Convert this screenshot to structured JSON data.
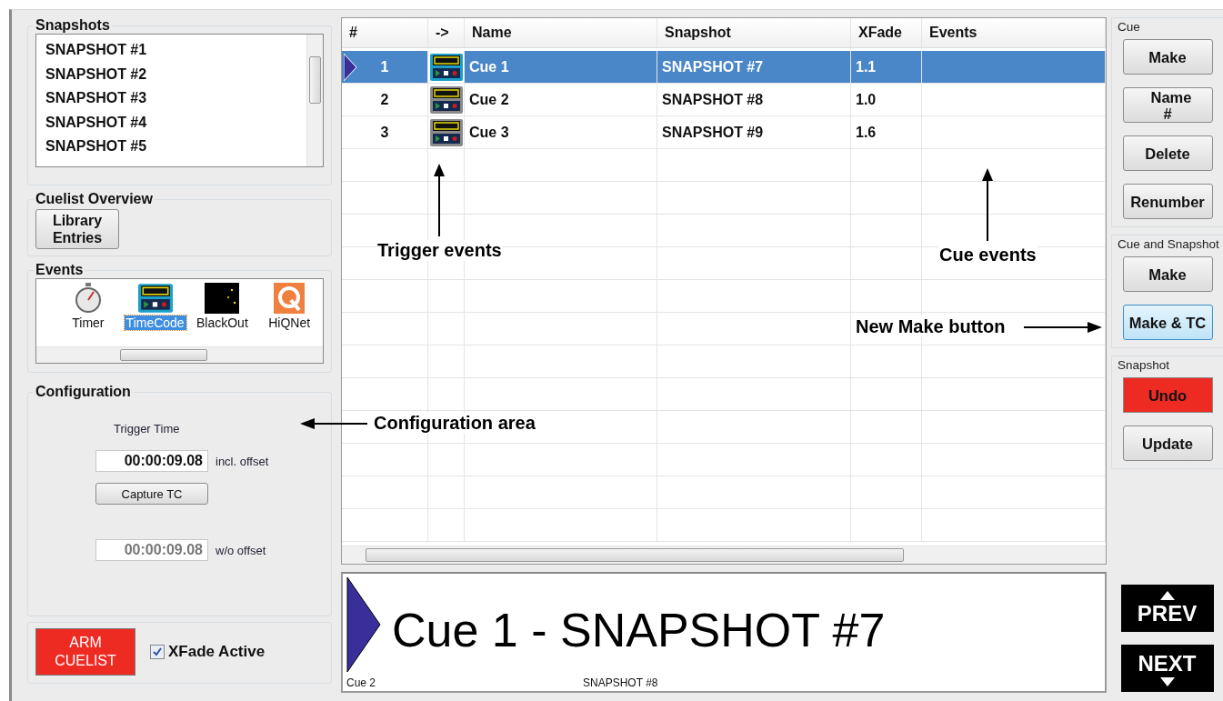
{
  "snapshots": {
    "title": "Snapshots",
    "items": [
      "SNAPSHOT #1",
      "SNAPSHOT #2",
      "SNAPSHOT #3",
      "SNAPSHOT #4",
      "SNAPSHOT #5"
    ]
  },
  "cuelist_overview": {
    "title": "Cuelist Overview",
    "button": "Library Entries"
  },
  "events": {
    "title": "Events",
    "items": [
      {
        "label": "Timer",
        "kind": "timer",
        "selected": false
      },
      {
        "label": "TimeCode",
        "kind": "timecode",
        "selected": true
      },
      {
        "label": "BlackOut",
        "kind": "blackout",
        "selected": false
      },
      {
        "label": "HiQNet",
        "kind": "hiqnet",
        "selected": false
      }
    ]
  },
  "configuration": {
    "title": "Configuration",
    "trigger_label": "Trigger Time",
    "fields": [
      {
        "value": "00:00:09.08",
        "label": "incl. offset",
        "disabled": false
      },
      {
        "value": "00:00:09.08",
        "label": "w/o offset",
        "disabled": true
      }
    ],
    "capture_button": "Capture TC"
  },
  "arm_button": "ARM CUELIST",
  "xfade": {
    "label": "XFade Active",
    "checked": true
  },
  "table": {
    "columns": [
      "#",
      "->",
      "Name",
      "Snapshot",
      "XFade",
      "Events"
    ],
    "rows": [
      {
        "number": "1",
        "name": "Cue 1",
        "snapshot": "SNAPSHOT #7",
        "xfade": "1.1",
        "selected": true
      },
      {
        "number": "2",
        "name": "Cue 2",
        "snapshot": "SNAPSHOT #8",
        "xfade": "1.0",
        "selected": false
      },
      {
        "number": "3",
        "name": "Cue 3",
        "snapshot": "SNAPSHOT #9",
        "xfade": "1.6",
        "selected": false
      }
    ]
  },
  "display": {
    "current": "Cue 1 - SNAPSHOT #7",
    "next_cue": "Cue 2",
    "next_snapshot": "SNAPSHOT #8"
  },
  "groups": [
    {
      "title": "Cue",
      "buttons": [
        {
          "label": "Make",
          "kind": "normal"
        },
        {
          "label": "Name #",
          "kind": "normal"
        },
        {
          "label": "Delete",
          "kind": "normal"
        },
        {
          "label": "Renumber",
          "kind": "normal"
        }
      ]
    },
    {
      "title": "Cue and Snapshot",
      "buttons": [
        {
          "label": "Make",
          "kind": "normal"
        },
        {
          "label": "Make & TC",
          "kind": "highlight"
        }
      ]
    },
    {
      "title": "Snapshot",
      "buttons": [
        {
          "label": "Undo",
          "kind": "danger"
        },
        {
          "label": "Update",
          "kind": "normal"
        }
      ]
    }
  ],
  "nav": [
    {
      "label": "PREV",
      "kind": "up"
    },
    {
      "label": "NEXT",
      "kind": "down"
    }
  ],
  "annotations": [
    {
      "text": "Trigger events",
      "kind": "up"
    },
    {
      "text": "Cue events",
      "kind": "up"
    },
    {
      "text": "Configuration area",
      "kind": "left"
    },
    {
      "text": "New Make button",
      "kind": "right"
    }
  ]
}
